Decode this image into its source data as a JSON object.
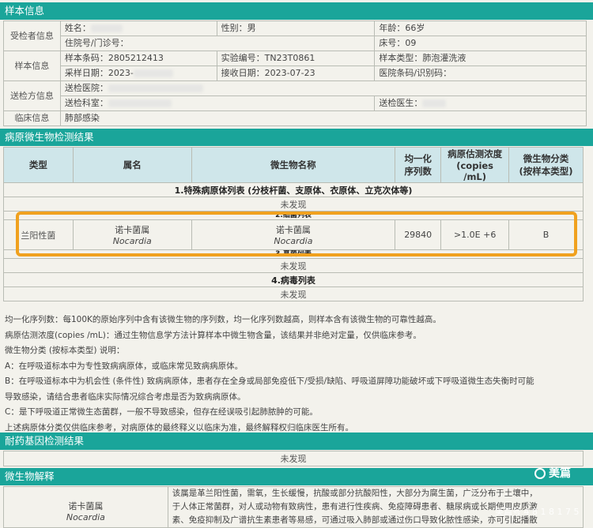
{
  "sample_section": {
    "title": "样本信息"
  },
  "patient": {
    "label": "受检者信息",
    "name_label": "姓名：",
    "gender": "性别：男",
    "age": "年龄：66岁",
    "inpatient_label": "住院号/门诊号：",
    "bed": "床号：09"
  },
  "sample": {
    "label": "样本信息",
    "barcode": "样本条码：2805212413",
    "lab_no": "实验编号：TN23T0861",
    "type": "样本类型：肺泡灌洗液",
    "collect_date": "采样日期：2023-",
    "receive_date": "接收日期：2023-07-23",
    "hospital_barcode": "医院条码/识别码："
  },
  "sender": {
    "label": "送检方信息",
    "hospital": "送检医院：",
    "dept": "送检科室：",
    "doctor": "送检医生："
  },
  "clinical": {
    "label": "临床信息",
    "value": "肺部感染"
  },
  "pathogen_section": {
    "title": "病原微生物检测结果"
  },
  "table_headers": {
    "type": "类型",
    "genus": "属名",
    "microbe": "微生物名称",
    "norm_reads_1": "均一化",
    "norm_reads_2": "序列数",
    "conc_1": "病原估测浓度",
    "conc_2": "(copies /mL)",
    "class_1": "微生物分类",
    "class_2": "(按样本类型)"
  },
  "groups": {
    "special": "1.特殊病原体列表 (分枝杆菌、支原体、衣原体、立克次体等)",
    "special_result": "未发现",
    "bacteria": "2.细菌列表",
    "fungi": "3.真菌列表",
    "fungi_result": "未发现",
    "virus": "4.病毒列表",
    "virus_result": "未发现"
  },
  "result_row": {
    "type": "兰阳性菌",
    "genus_cn": "诺卡菌属",
    "genus_latin": "Nocardia",
    "microbe_cn": "诺卡菌属",
    "microbe_latin": "Nocardia",
    "reads": "29840",
    "conc": ">1.0E +6",
    "class": "B"
  },
  "notes": [
    "均一化序列数：每100K的原始序列中含有该微生物的序列数，均一化序列数越高，则样本含有该微生物的可靠性越高。",
    "病原估测浓度(copies /mL)：通过生物信息学方法计算样本中微生物含量，该结果并非绝对定量，仅供临床参考。",
    "微生物分类 (按标本类型) 说明：",
    "A：在呼吸道标本中为专性致病病原体，或临床常见致病病原体。",
    "B：在呼吸道标本中为机会性 (条件性) 致病病原体，患者存在全身或局部免疫低下/受损/缺陷、呼吸道屏障功能破坏或下呼吸道微生态失衡时可能",
    "导致感染，请结合患者临床实际情况综合考虑是否为致病病原体。",
    "C：是下呼吸道正常微生态菌群，一般不导致感染，但存在经误吸引起肺脓肿的可能。",
    "上述病原体分类仅供临床参考，对病原体的最终释义以临床为准，最终解释权归临床医生所有。"
  ],
  "resistance_section": {
    "title": "耐药基因检测结果",
    "result": "未发现"
  },
  "interpretation_section": {
    "title": "微生物解释"
  },
  "interpretation": {
    "genus_cn": "诺卡菌属",
    "genus_latin": "Nocardia",
    "lines": [
      "该属是革兰阳性菌，需氧，生长缓慢，抗酸或部分抗酸阳性，大部分为腐生菌，广泛分布于土壤中，",
      "于人体正常菌群，对人或动物有致病性，患有进行性疾病、免疫障碍患者、糖尿病或长期使用皮质激",
      "素、免疫抑制及广谱抗生素患者等易感，可通过吸入肺部或通过伤口导致化脓性感染，亦可引起播散"
    ]
  },
  "watermark": {
    "brand": "美篇",
    "id": "美篇号 4 8 1 8 1 7 5"
  },
  "colors": {
    "header_bar": "#1aa59a",
    "table_header": "#cfe6ea",
    "highlight": "#f0a11e"
  }
}
